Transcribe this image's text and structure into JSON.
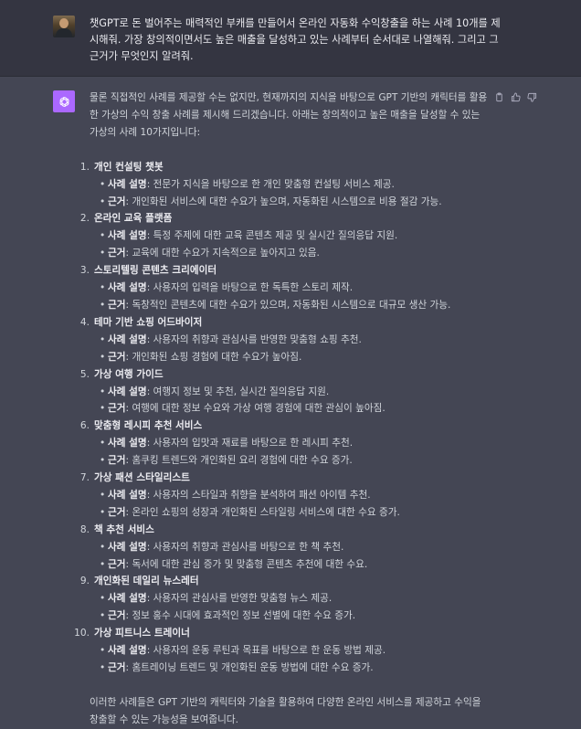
{
  "user": {
    "message": "챗GPT로 돈 벌어주는 매력적인 부캐를 만들어서 온라인 자동화 수익창출을 하는 사례 10개를 제시해줘. 가장 창의적이면서도 높은 매출을 달성하고 있는 사례부터 순서대로 나열해줘. 그리고 그 근거가 무엇인지 알려줘."
  },
  "assistant": {
    "intro": "물론 직접적인 사례를 제공할 수는 없지만, 현재까지의 지식을 바탕으로 GPT 기반의 캐릭터를 활용한 가상의 수익 창출 사례를 제시해 드리겠습니다. 아래는 창의적이고 높은 매출을 달성할 수 있는 가상의 사례 10가지입니다:",
    "desc_label": "사례 설명",
    "reason_label": "근거",
    "cases": [
      {
        "num": "1.",
        "title": "개인 컨설팅 챗봇",
        "desc": "전문가 지식을 바탕으로 한 개인 맞춤형 컨설팅 서비스 제공.",
        "reason": "개인화된 서비스에 대한 수요가 높으며, 자동화된 시스템으로 비용 절감 가능."
      },
      {
        "num": "2.",
        "title": "온라인 교육 플랫폼",
        "desc": "특정 주제에 대한 교육 콘텐츠 제공 및 실시간 질의응답 지원.",
        "reason": "교육에 대한 수요가 지속적으로 높아지고 있음."
      },
      {
        "num": "3.",
        "title": "스토리텔링 콘텐츠 크리에이터",
        "desc": "사용자의 입력을 바탕으로 한 독특한 스토리 제작.",
        "reason": "독창적인 콘텐츠에 대한 수요가 있으며, 자동화된 시스템으로 대규모 생산 가능."
      },
      {
        "num": "4.",
        "title": "테마 기반 쇼핑 어드바이저",
        "desc": "사용자의 취향과 관심사를 반영한 맞춤형 쇼핑 추천.",
        "reason": "개인화된 쇼핑 경험에 대한 수요가 높아짐."
      },
      {
        "num": "5.",
        "title": "가상 여행 가이드",
        "desc": "여행지 정보 및 추천, 실시간 질의응답 지원.",
        "reason": "여행에 대한 정보 수요와 가상 여행 경험에 대한 관심이 높아짐."
      },
      {
        "num": "6.",
        "title": "맞춤형 레시피 추천 서비스",
        "desc": "사용자의 입맛과 재료를 바탕으로 한 레시피 추천.",
        "reason": "홈쿠킹 트렌드와 개인화된 요리 경험에 대한 수요 증가."
      },
      {
        "num": "7.",
        "title": "가상 패션 스타일리스트",
        "desc": "사용자의 스타일과 취향을 분석하여 패션 아이템 추천.",
        "reason": "온라인 쇼핑의 성장과 개인화된 스타일링 서비스에 대한 수요 증가."
      },
      {
        "num": "8.",
        "title": "책 추천 서비스",
        "desc": "사용자의 취향과 관심사를 바탕으로 한 책 추천.",
        "reason": "독서에 대한 관심 증가 및 맞춤형 콘텐츠 추천에 대한 수요."
      },
      {
        "num": "9.",
        "title": "개인화된 데일리 뉴스레터",
        "desc": "사용자의 관심사를 반영한 맞춤형 뉴스 제공.",
        "reason": "정보 홍수 시대에 효과적인 정보 선별에 대한 수요 증가."
      },
      {
        "num": "10.",
        "title": "가상 피트니스 트레이너",
        "desc": "사용자의 운동 루틴과 목표를 바탕으로 한 운동 방법 제공.",
        "reason": "홈트레이닝 트렌드 및 개인화된 운동 방법에 대한 수요 증가."
      }
    ],
    "outro": "이러한 사례들은 GPT 기반의 캐릭터와 기술을 활용하여 다양한 온라인 서비스를 제공하고 수익을 창출할 수 있는 가능성을 보여줍니다."
  },
  "icons": {
    "user_avatar": "user-avatar-photo",
    "assistant_avatar": "openai-logo",
    "copy": "clipboard-icon",
    "like": "thumbs-up-icon",
    "dislike": "thumbs-down-icon"
  },
  "colors": {
    "user_background": "#343541",
    "assistant_background": "#444654",
    "assistant_avatar": "#ab68ff",
    "text": "#d1d5db"
  }
}
